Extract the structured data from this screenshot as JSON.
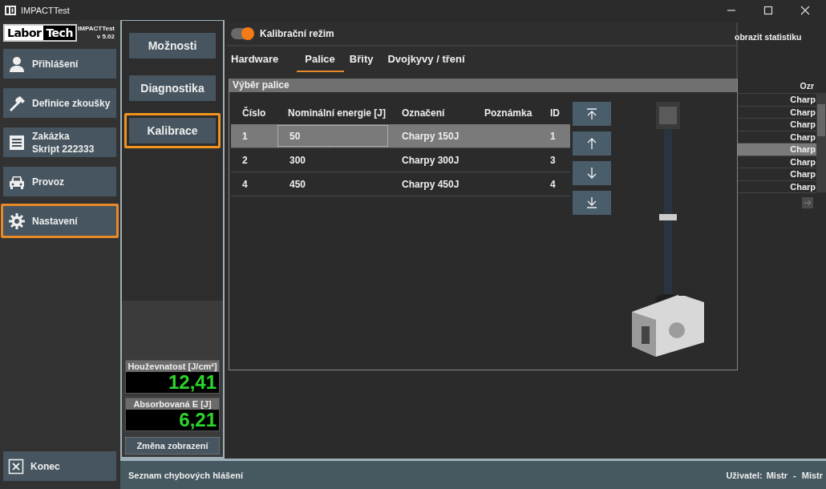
{
  "window": {
    "title": "IMPACTTest"
  },
  "logo": {
    "part_1": "Labor",
    "part_2": "Tech"
  },
  "app": {
    "name": "IMPACTTest",
    "version": "v 5.02"
  },
  "sidebar": {
    "items": [
      {
        "label": "Přihlášení",
        "kind": "user",
        "selected": false
      },
      {
        "label": "Definice zkoušky",
        "kind": "hammer",
        "selected": false
      },
      {
        "label": "Zakázka",
        "detail": "Skript 222333",
        "kind": "list",
        "selected": false
      },
      {
        "label": "Provoz",
        "kind": "car",
        "selected": false
      },
      {
        "label": "Nastavení",
        "kind": "gear",
        "selected": true
      }
    ],
    "exit_button": "Konec"
  },
  "submenu": {
    "items": [
      {
        "label": "Možnosti",
        "selected": false
      },
      {
        "label": "Diagnostika",
        "selected": false
      },
      {
        "label": "Kalibrace",
        "selected": true
      }
    ]
  },
  "meters": [
    {
      "label": "Houževnatost [J/cm²]",
      "value": "12,41"
    },
    {
      "label": "Absorbovaná E [J]",
      "value": "6,21"
    }
  ],
  "display_button": "Změna zobrazení",
  "background_panel": {
    "link": "obrazit statistiku",
    "column_header": "Ozr",
    "rows": [
      {
        "text": "Charp",
        "selected": false
      },
      {
        "text": "Charp",
        "selected": false
      },
      {
        "text": "Charp",
        "selected": false
      },
      {
        "text": "Charp",
        "selected": false
      },
      {
        "text": "Charp",
        "selected": true
      },
      {
        "text": "Charp",
        "selected": false
      },
      {
        "text": "Charp",
        "selected": false
      },
      {
        "text": "Charp",
        "selected": false
      }
    ]
  },
  "calibration": {
    "mode_label": "Kalibrační režim",
    "mode_on": true,
    "tabs": [
      {
        "label": "Hardware",
        "selected": false
      },
      {
        "label": "Palice",
        "selected": true
      },
      {
        "label": "Břity",
        "selected": false
      },
      {
        "label": "Dvojkyvy / tření",
        "selected": false
      }
    ],
    "group_title": "Výběr palice",
    "columns": [
      "Číslo",
      "Nominální energie [J]",
      "Označení",
      "Poznámka",
      "ID"
    ],
    "rows": [
      {
        "number": "1",
        "energy": "50",
        "designation": "Charpy 150J",
        "id": "1",
        "selected": true
      },
      {
        "number": "2",
        "energy": "300",
        "designation": "Charpy 300J",
        "id": "3",
        "selected": false
      },
      {
        "number": "4",
        "energy": "450",
        "designation": "Charpy 450J",
        "id": "4",
        "selected": false
      }
    ]
  },
  "status_bar": {
    "errors": "Seznam chybových hlášení",
    "user_label": "Uživatel:",
    "user": "Mistr - Mistr"
  }
}
